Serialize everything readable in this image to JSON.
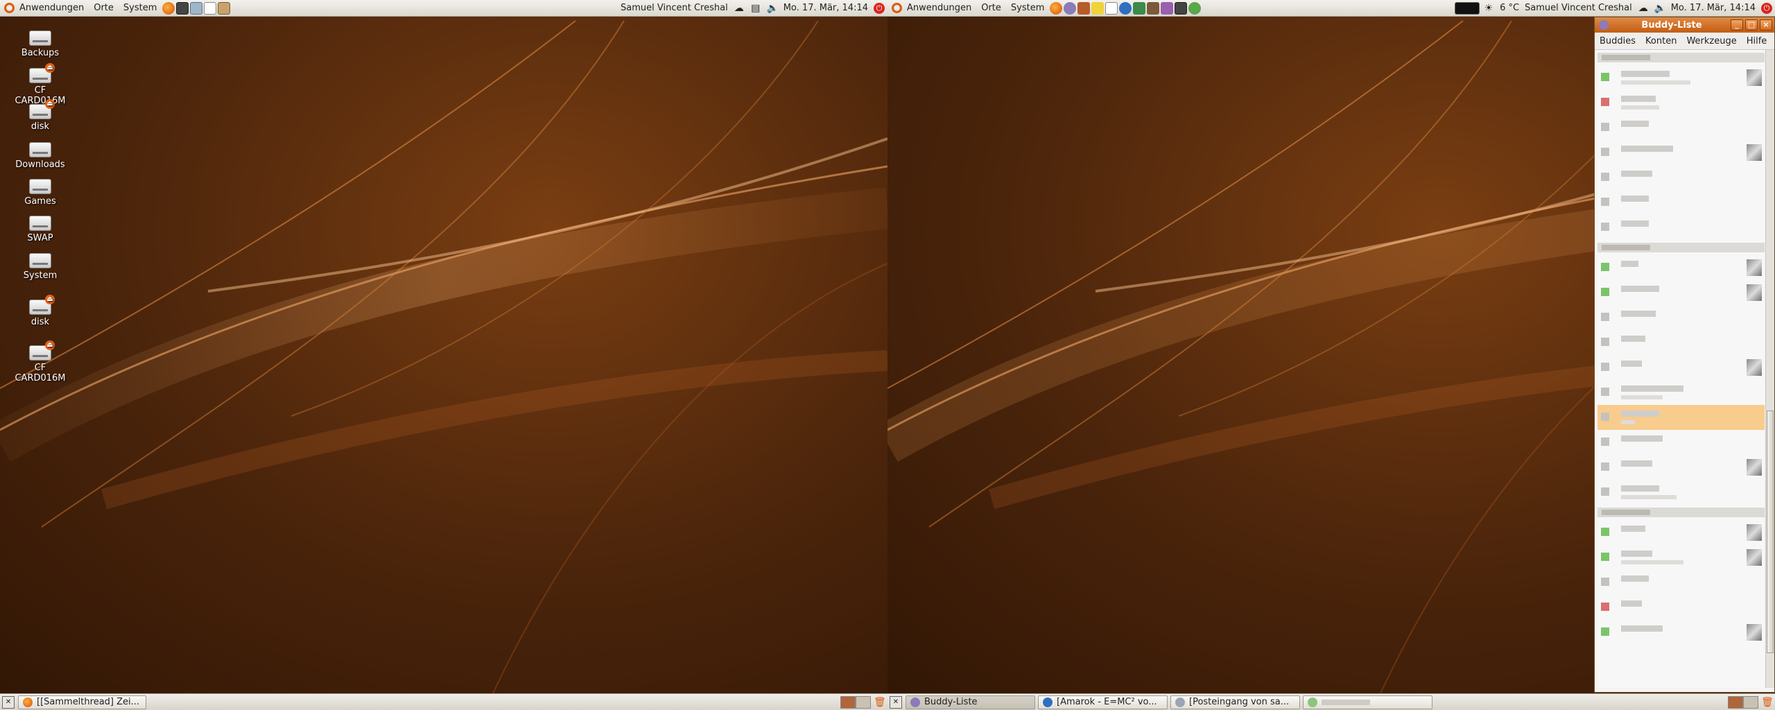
{
  "left_screen": {
    "top_panel": {
      "menus": [
        "Anwendungen",
        "Orte",
        "System"
      ],
      "user_name": "Samuel Vincent Creshal",
      "datetime": "Mo. 17. Mär, 14:14"
    },
    "desktop_icons": [
      {
        "label": "Backups",
        "badge": false
      },
      {
        "label": "CF CARD016M",
        "badge": true
      },
      {
        "label": "disk",
        "badge": true
      },
      {
        "label": "Downloads",
        "badge": false
      },
      {
        "label": "Games",
        "badge": false
      },
      {
        "label": "SWAP",
        "badge": false
      },
      {
        "label": "System",
        "badge": false
      },
      {
        "label": "disk",
        "badge": true
      },
      {
        "label": "CF CARD016M",
        "badge": true
      }
    ],
    "taskbar": [
      {
        "title": "[[Sammelthread] Zei...",
        "active": false
      }
    ]
  },
  "right_screen": {
    "top_panel": {
      "menus": [
        "Anwendungen",
        "Orte",
        "System"
      ],
      "weather": "6 °C",
      "user_name": "Samuel Vincent Creshal",
      "datetime": "Mo. 17. Mär, 14:14"
    },
    "taskbar": [
      {
        "title": "Buddy-Liste",
        "active": true
      },
      {
        "title": "[Amarok - E=MC² vo...",
        "active": false
      },
      {
        "title": "[Posteingang von sa...",
        "active": false
      },
      {
        "title": "",
        "active": false
      }
    ],
    "buddy_window": {
      "title": "Buddy-Liste",
      "menu": [
        "Buddies",
        "Konten",
        "Werkzeuge",
        "Hilfe"
      ]
    }
  },
  "colors": {
    "accent": "#d95b0e",
    "wallpaper_dark": "#3b1f0a",
    "wallpaper_light": "#c8783a",
    "selection": "#f8cc8d",
    "status_online": "#7dc36a",
    "status_busy": "#d9706f",
    "status_offline": "#c4c2bf"
  },
  "icons": {
    "launchers_left": [
      "firefox-icon",
      "terminal-icon",
      "network-icon",
      "text-editor-icon",
      "package-icon"
    ],
    "launchers_right": [
      "firefox-icon",
      "pidgin-icon",
      "package-icon",
      "edit-icon",
      "thermometer-icon",
      "browser-icon",
      "monitor-icon",
      "gimp-icon",
      "dictionary-icon",
      "terminal-icon",
      "game-icon"
    ]
  }
}
